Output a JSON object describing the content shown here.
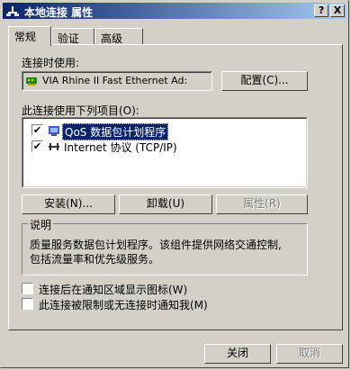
{
  "window": {
    "title": "本地连接 属性",
    "help_btn": "?",
    "close_btn": "X"
  },
  "tabs": [
    {
      "label": "常规"
    },
    {
      "label": "验证"
    },
    {
      "label": "高级"
    }
  ],
  "connect_using": {
    "label": "连接时使用:",
    "adapter": "VIA Rhine II Fast Ethernet Ad:",
    "configure_label": "配置(C)..."
  },
  "components": {
    "label": "此连接使用下列项目(O):",
    "items": [
      {
        "label": "QoS 数据包计划程序",
        "checked": true,
        "selected": true
      },
      {
        "label": "Internet 协议 (TCP/IP)",
        "checked": true,
        "selected": false
      }
    ]
  },
  "actions": {
    "install": "安装(N)...",
    "uninstall": "卸载(U)",
    "properties": "属性(R)"
  },
  "description": {
    "legend": "说明",
    "line1": "质量服务数据包计划程序。该组件提供网络交通控制,",
    "line2": "包括流量率和优先级服务。"
  },
  "options": {
    "show_icon": "连接后在通知区域显示图标(W)",
    "notify_limited": "此连接被限制或无连接时通知我(M)"
  },
  "footer": {
    "close": "关闭",
    "cancel": "取消"
  }
}
